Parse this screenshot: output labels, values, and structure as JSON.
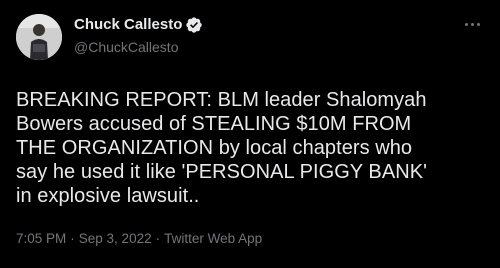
{
  "author": {
    "display_name": "Chuck Callesto",
    "handle": "@ChuckCallesto",
    "verified_icon": "verified-badge-icon",
    "badge_color": "#e7e9ea"
  },
  "more_icon": "more-options-icon",
  "tweet": {
    "lines": [
      "BREAKING REPORT: BLM leader Shalomyah",
      "Bowers accused of STEALING $10M FROM",
      "THE ORGANIZATION by local chapters who",
      "say he used it like 'PERSONAL PIGGY BANK'",
      "in explosive lawsuit.."
    ]
  },
  "meta": {
    "time": "7:05 PM",
    "separator": "·",
    "date": "Sep 3, 2022",
    "source": "Twitter Web App"
  },
  "colors": {
    "background": "#000000",
    "text_primary": "#e7e9ea",
    "text_secondary": "#71767b"
  }
}
